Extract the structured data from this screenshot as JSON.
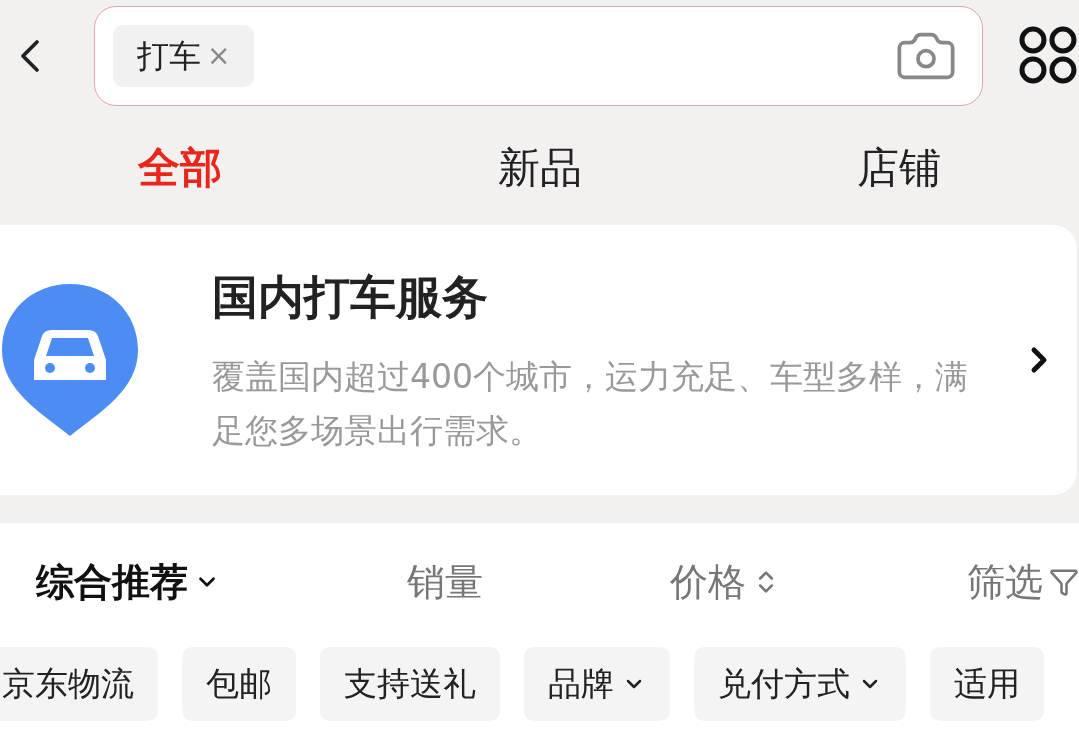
{
  "search": {
    "tag": "打车",
    "tag_remove": "×"
  },
  "tabs": [
    {
      "label": "全部",
      "selected": true
    },
    {
      "label": "新品",
      "selected": false
    },
    {
      "label": "店铺",
      "selected": false
    }
  ],
  "service_card": {
    "title": "国内打车服务",
    "description": "覆盖国内超过400个城市，运力充足、车型多样，满足您多场景出行需求。"
  },
  "sort_bar": [
    {
      "label": "综合推荐",
      "kind": "dropdown",
      "selected": true
    },
    {
      "label": "销量",
      "kind": "plain",
      "selected": false
    },
    {
      "label": "价格",
      "kind": "sort",
      "selected": false
    },
    {
      "label": "筛选",
      "kind": "filter",
      "selected": false
    }
  ],
  "filter_chips": [
    {
      "label": "京东物流",
      "kind": "plain"
    },
    {
      "label": "包邮",
      "kind": "plain"
    },
    {
      "label": "支持送礼",
      "kind": "plain"
    },
    {
      "label": "品牌",
      "kind": "dropdown"
    },
    {
      "label": "兑付方式",
      "kind": "dropdown"
    },
    {
      "label": "适用",
      "kind": "plain"
    }
  ]
}
